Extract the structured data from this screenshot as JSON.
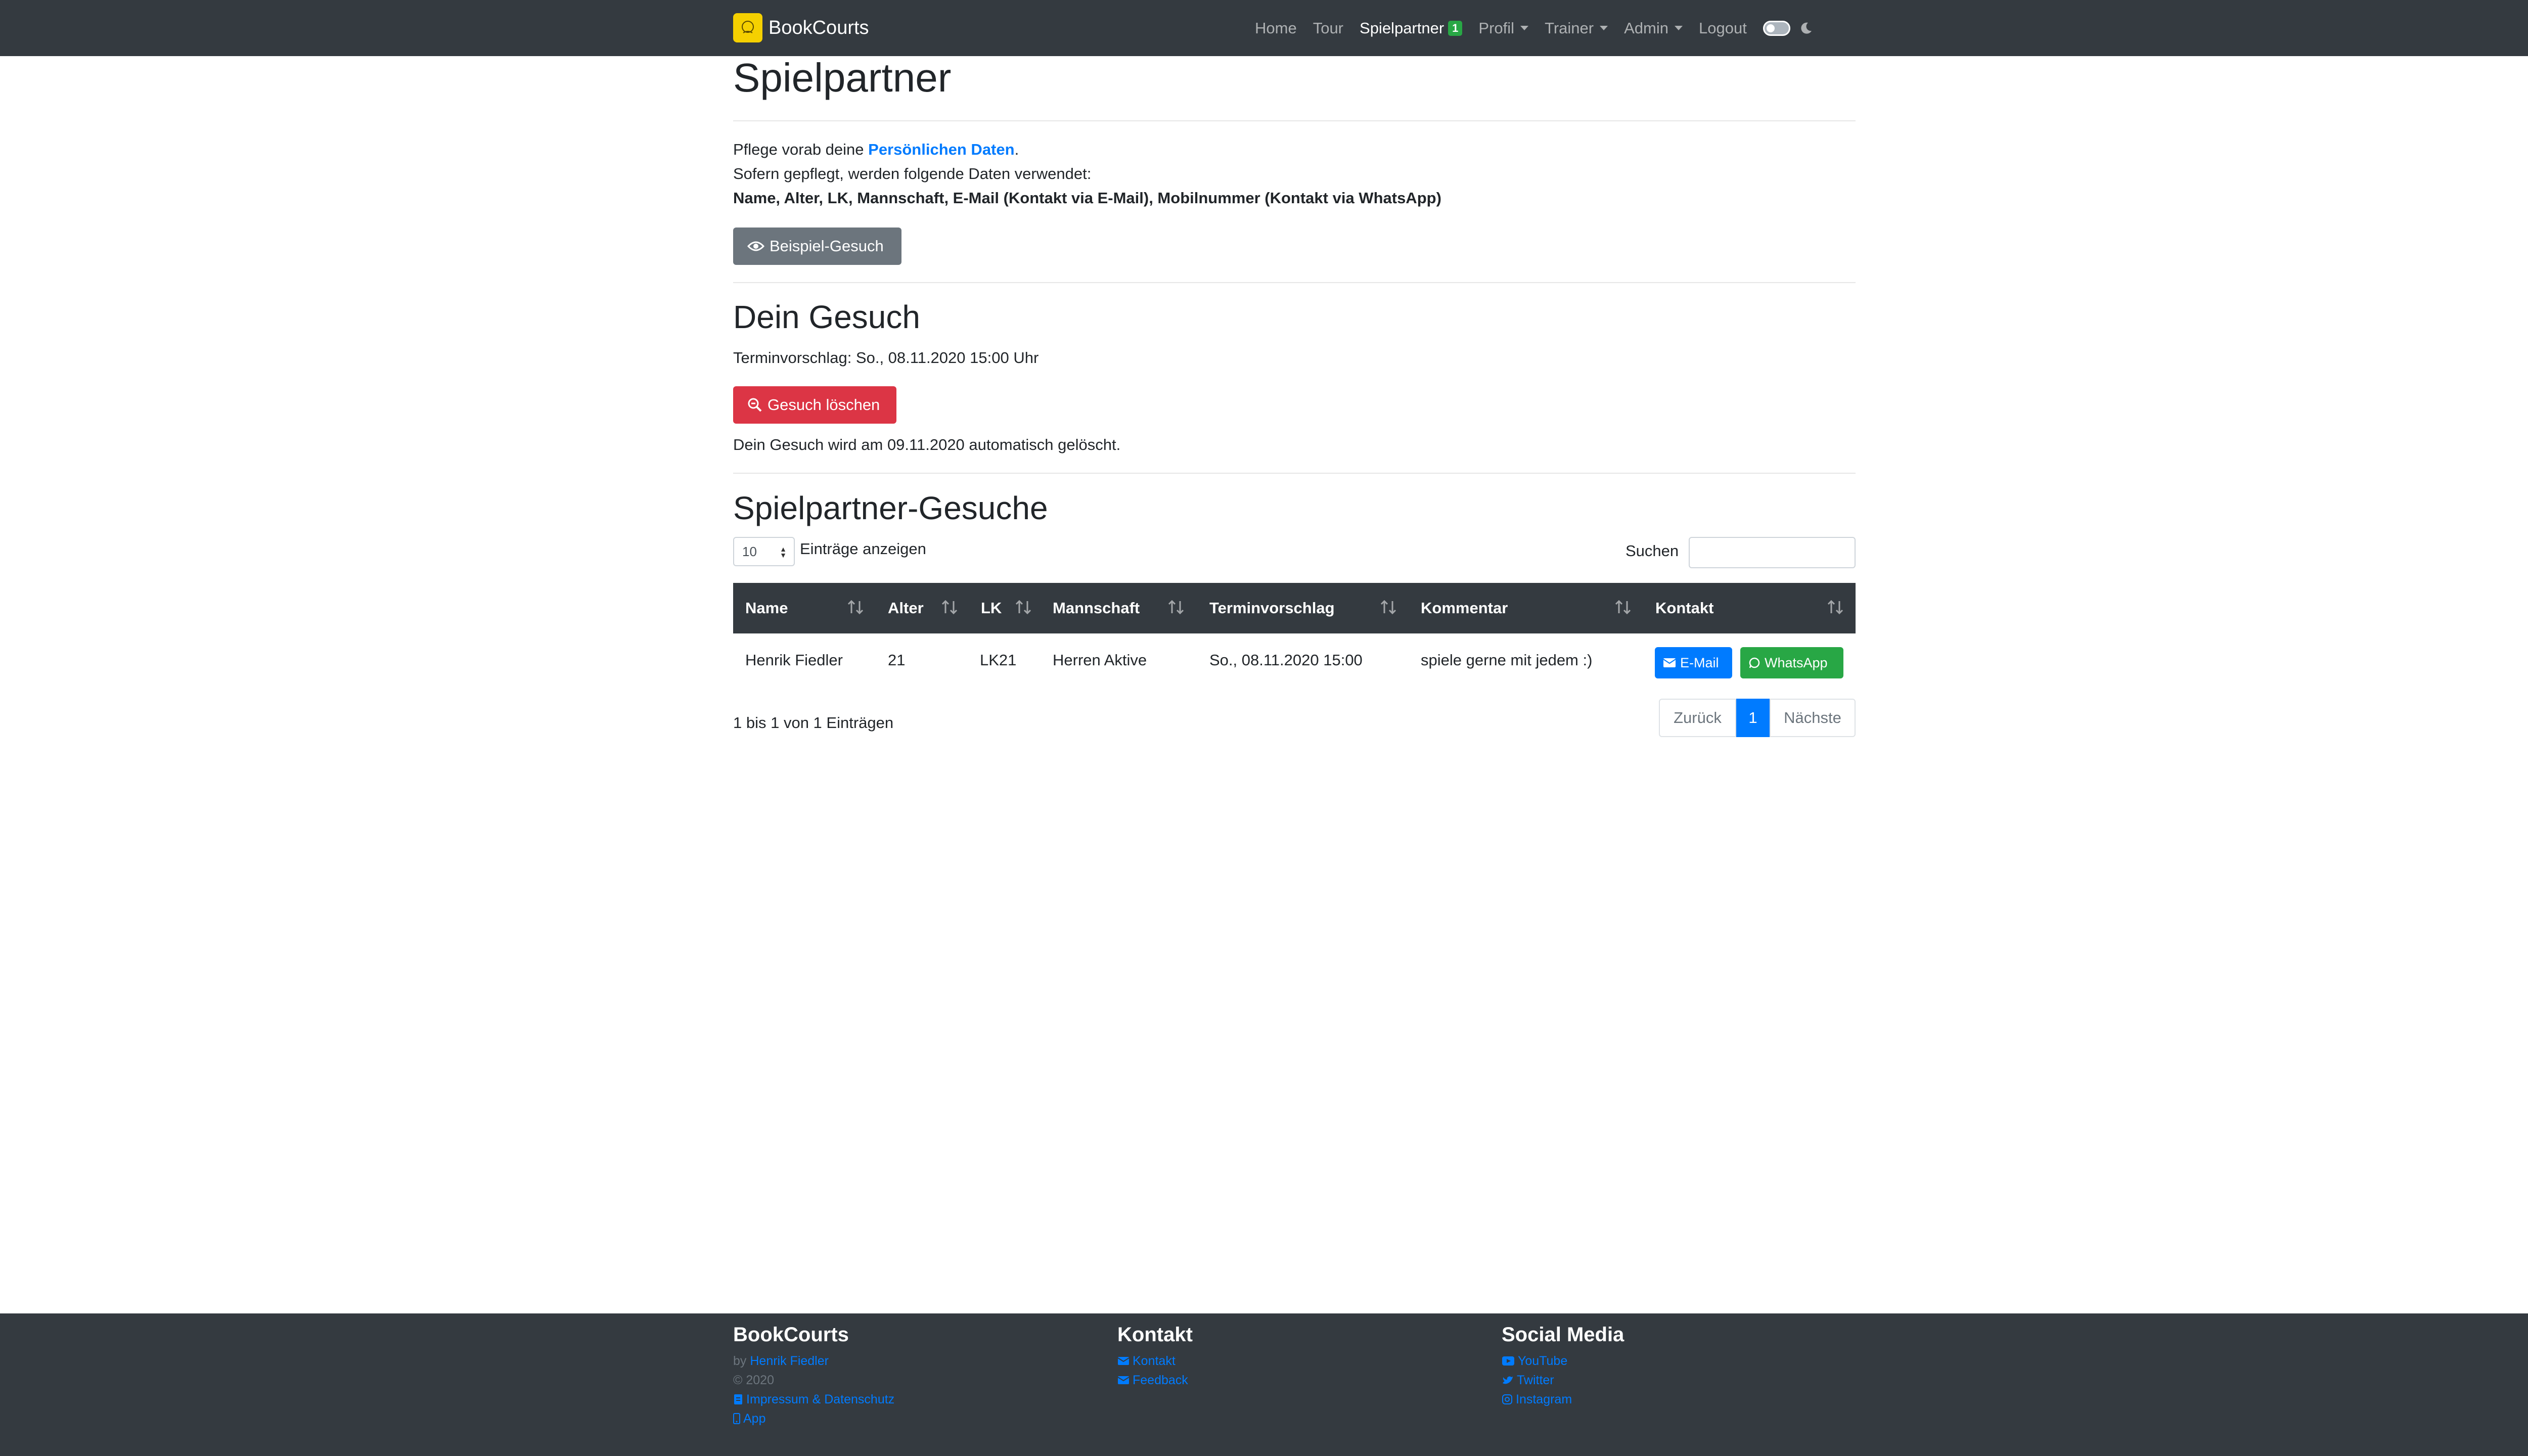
{
  "navbar": {
    "brand": "BookCourts",
    "items": [
      {
        "label": "Home"
      },
      {
        "label": "Tour"
      },
      {
        "label": "Spielpartner",
        "badge": "1"
      },
      {
        "label": "Profil"
      },
      {
        "label": "Trainer"
      },
      {
        "label": "Admin"
      },
      {
        "label": "Logout"
      }
    ]
  },
  "page": {
    "title": "Spielpartner",
    "intro_prefix": "Pflege vorab deine ",
    "intro_link": "Persönlichen Daten",
    "intro_suffix": ".",
    "intro_line2": "Sofern gepflegt, werden folgende Daten verwendet:",
    "intro_line3": "Name, Alter, LK, Mannschaft, E-Mail (Kontakt via E-Mail), Mobilnummer (Kontakt via WhatsApp)",
    "example_button": "Beispiel-Gesuch"
  },
  "own_request": {
    "heading": "Dein Gesuch",
    "proposal": "Terminvorschlag: So., 08.11.2020 15:00 Uhr",
    "delete_button": "Gesuch löschen",
    "auto_delete_note": "Dein Gesuch wird am 09.11.2020 automatisch gelöscht."
  },
  "requests": {
    "heading": "Spielpartner-Gesuche",
    "page_length": "10",
    "page_length_label": "Einträge anzeigen",
    "search_label": "Suchen",
    "search_value": "",
    "columns": [
      "Name",
      "Alter",
      "LK",
      "Mannschaft",
      "Terminvorschlag",
      "Kommentar",
      "Kontakt"
    ],
    "rows": [
      {
        "name": "Henrik Fiedler",
        "age": "21",
        "lk": "LK21",
        "team": "Herren Aktive",
        "proposal": "So., 08.11.2020 15:00",
        "comment": "spiele gerne mit jedem :)",
        "email_label": "E-Mail",
        "whatsapp_label": "WhatsApp"
      }
    ],
    "info": "1 bis 1 von 1 Einträgen",
    "pagination": {
      "prev": "Zurück",
      "current": "1",
      "next": "Nächste"
    }
  },
  "footer": {
    "col1": {
      "heading": "BookCourts",
      "by_prefix": "by ",
      "author": "Henrik Fiedler",
      "copyright": "© 2020",
      "imprint": "Impressum & Datenschutz",
      "app": "App"
    },
    "col2": {
      "heading": "Kontakt",
      "contact": "Kontakt",
      "feedback": "Feedback"
    },
    "col3": {
      "heading": "Social Media",
      "youtube": "YouTube",
      "twitter": "Twitter",
      "instagram": "Instagram"
    }
  },
  "colors": {
    "navbar_bg": "#343a40",
    "primary": "#007bff",
    "success": "#28a745",
    "danger": "#dc3545",
    "secondary": "#6c757d",
    "brand_logo": "#f5d000"
  }
}
